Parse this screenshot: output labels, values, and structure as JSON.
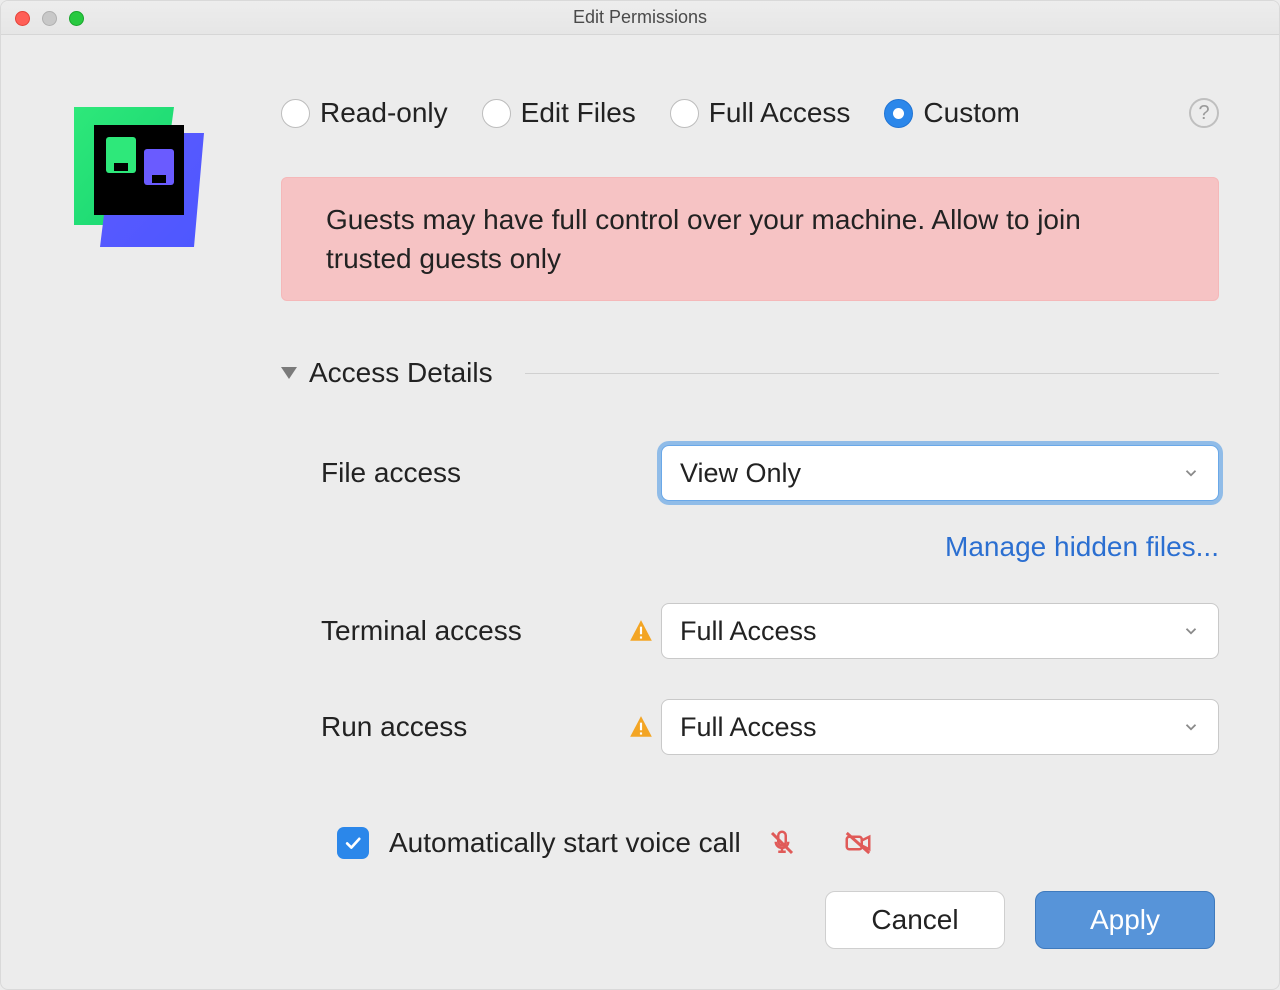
{
  "window": {
    "title": "Edit Permissions"
  },
  "radios": {
    "read_only": "Read-only",
    "edit_files": "Edit Files",
    "full_access": "Full Access",
    "custom": "Custom"
  },
  "warning_banner": "Guests may have full control over your machine. Allow to join trusted guests only",
  "section": {
    "access_details": "Access Details"
  },
  "details": {
    "file_access": {
      "label": "File access",
      "value": "View Only"
    },
    "manage_hidden": "Manage hidden files...",
    "terminal_access": {
      "label": "Terminal access",
      "value": "Full Access"
    },
    "run_access": {
      "label": "Run access",
      "value": "Full Access"
    }
  },
  "voice_call": {
    "label": "Automatically start voice call",
    "checked": true
  },
  "buttons": {
    "cancel": "Cancel",
    "apply": "Apply"
  },
  "help": "?"
}
